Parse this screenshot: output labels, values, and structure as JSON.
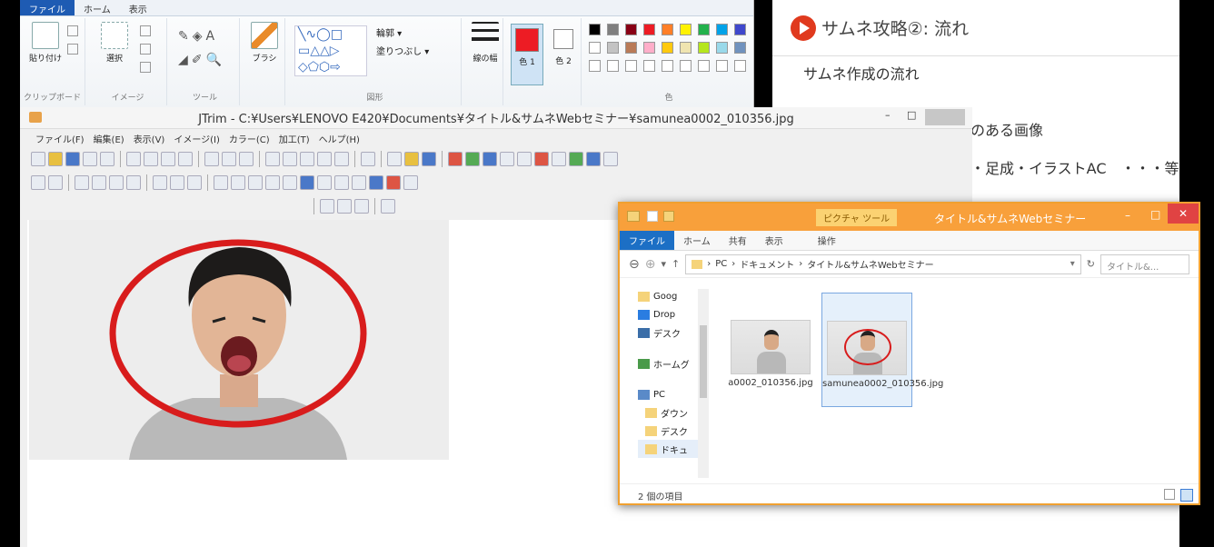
{
  "paint": {
    "tabs": [
      "ファイル",
      "ホーム",
      "表示"
    ],
    "clipboard": {
      "paste": "貼り付け",
      "label": "クリップボード"
    },
    "image": {
      "select": "選択",
      "label": "イメージ"
    },
    "tools": {
      "label": "ツール"
    },
    "brush": "ブラシ",
    "shapes": {
      "outline": "輪郭",
      "fill": "塗りつぶし",
      "label": "図形"
    },
    "line_width": "線の幅",
    "color1": "色 1",
    "color2": "色 2",
    "colors_label": "色",
    "palette": [
      "#000000",
      "#7f7f7f",
      "#880015",
      "#ed1c24",
      "#ff7f27",
      "#fff200",
      "#22b14c",
      "#00a2e8",
      "#3f48cc",
      "#ffffff",
      "#c3c3c3",
      "#b97a57",
      "#ffaec9",
      "#ffc90e",
      "#efe4b0",
      "#b5e61d",
      "#99d9ea",
      "#7092be"
    ]
  },
  "jtrim": {
    "title": "JTrim - C:¥Users¥LENOVO E420¥Documents¥タイトル&サムネWebセミナー¥samunea0002_010356.jpg",
    "menu": [
      "ファイル(F)",
      "編集(E)",
      "表示(V)",
      "イメージ(I)",
      "カラー(C)",
      "加工(T)",
      "ヘルプ(H)"
    ]
  },
  "slide": {
    "title": "サムネ攻略②: 流れ",
    "subtitle": "サムネ作成の流れ",
    "line1": "のある画像",
    "line2": "・足成・イラストAC　・・・等"
  },
  "explorer": {
    "context_tab": "ピクチャ ツール",
    "title": "タイトル&サムネWebセミナー",
    "tabs": [
      "ファイル",
      "ホーム",
      "共有",
      "表示",
      "操作"
    ],
    "breadcrumb": [
      "PC",
      "ドキュメント",
      "タイトル&サムネWebセミナー"
    ],
    "search_placeholder": "タイトル&...",
    "nav": [
      "Goog",
      "Drop",
      "デスク",
      "ホームグ",
      "PC",
      "ダウン",
      "デスク",
      "ドキュ"
    ],
    "files": [
      {
        "name": "a0002_010356.jpg"
      },
      {
        "name": "samunea0002_010356.jpg"
      }
    ],
    "status": "2 個の項目",
    "accent": "#f8a03b"
  }
}
